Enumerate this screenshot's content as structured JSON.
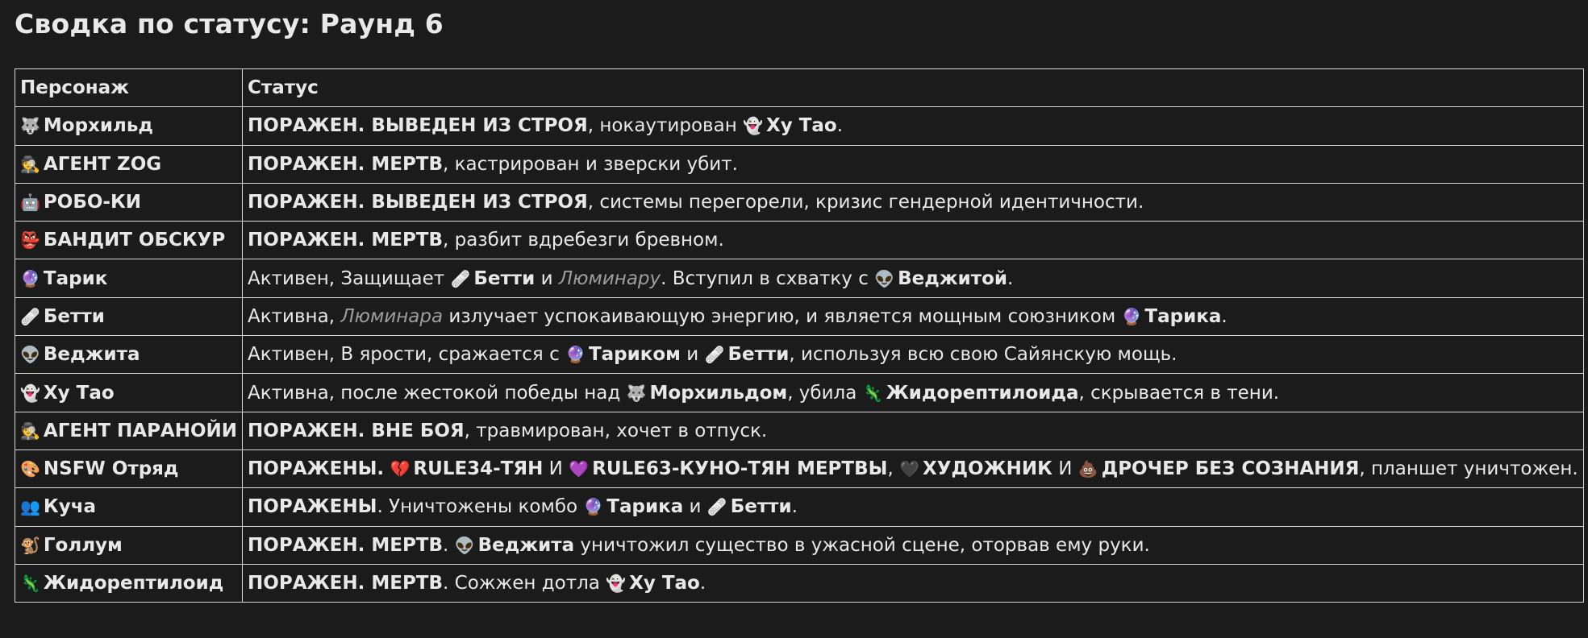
{
  "page": {
    "title": "Сводка по статусу: Раунд 6"
  },
  "table": {
    "headers": [
      "Персонаж",
      "Статус"
    ],
    "rows": [
      {
        "emoji": "🐺",
        "name": "Морхильд",
        "status": [
          {
            "t": "ПОРАЖЕН. ВЫВЕДЕН ИЗ СТРОЯ",
            "s": "b"
          },
          {
            "t": ", нокаутирован "
          },
          {
            "t": "👻",
            "s": "e"
          },
          {
            "t": "Ху Тао",
            "s": "b"
          },
          {
            "t": "."
          }
        ]
      },
      {
        "emoji": "🕵️",
        "name": "АГЕНТ ZOG",
        "status": [
          {
            "t": "ПОРАЖЕН. МЕРТВ",
            "s": "b"
          },
          {
            "t": ", кастрирован и зверски убит."
          }
        ]
      },
      {
        "emoji": "🤖",
        "name": "РОБО-КИ",
        "status": [
          {
            "t": "ПОРАЖЕН. ВЫВЕДЕН ИЗ СТРОЯ",
            "s": "b"
          },
          {
            "t": ", системы перегорели, кризис гендерной идентичности."
          }
        ]
      },
      {
        "emoji": "👺",
        "name": "БАНДИТ ОБСКУР",
        "status": [
          {
            "t": "ПОРАЖЕН. МЕРТВ",
            "s": "b"
          },
          {
            "t": ", разбит вдребезги бревном."
          }
        ]
      },
      {
        "emoji": "🔮",
        "name": "Тарик",
        "status": [
          {
            "t": "Активен, Защищает "
          },
          {
            "t": "🩹",
            "s": "e"
          },
          {
            "t": "Бетти",
            "s": "b"
          },
          {
            "t": " и "
          },
          {
            "t": "Люминару",
            "s": "i"
          },
          {
            "t": ". Вступил в схватку с "
          },
          {
            "t": "👽",
            "s": "e"
          },
          {
            "t": "Веджитой",
            "s": "b"
          },
          {
            "t": "."
          }
        ]
      },
      {
        "emoji": "🩹",
        "name": "Бетти",
        "status": [
          {
            "t": "Активна, "
          },
          {
            "t": "Люминара",
            "s": "i"
          },
          {
            "t": " излучает успокаивающую энергию, и является мощным союзником "
          },
          {
            "t": "🔮",
            "s": "e"
          },
          {
            "t": "Тарика",
            "s": "b"
          },
          {
            "t": "."
          }
        ]
      },
      {
        "emoji": "👽",
        "name": "Веджита",
        "status": [
          {
            "t": "Активен, В ярости, сражается с "
          },
          {
            "t": "🔮",
            "s": "e"
          },
          {
            "t": "Тариком",
            "s": "b"
          },
          {
            "t": " и "
          },
          {
            "t": "🩹",
            "s": "e"
          },
          {
            "t": "Бетти",
            "s": "b"
          },
          {
            "t": ", используя всю свою Сайянскую мощь."
          }
        ]
      },
      {
        "emoji": "👻",
        "name": "Ху Тао",
        "status": [
          {
            "t": "Активна, после жестокой победы над "
          },
          {
            "t": "🐺",
            "s": "e"
          },
          {
            "t": "Морхильдом",
            "s": "b"
          },
          {
            "t": ", убила "
          },
          {
            "t": "🦎",
            "s": "e"
          },
          {
            "t": "Жидорептилоида",
            "s": "b"
          },
          {
            "t": ", скрывается в тени."
          }
        ]
      },
      {
        "emoji": "🕵️",
        "name": "АГЕНТ ПАРАНОЙИ",
        "status": [
          {
            "t": "ПОРАЖЕН. ВНЕ БОЯ",
            "s": "b"
          },
          {
            "t": ", травмирован, хочет в отпуск."
          }
        ]
      },
      {
        "emoji": "🎨",
        "name": "NSFW Отряд",
        "status": [
          {
            "t": "ПОРАЖЕНЫ.",
            "s": "b"
          },
          {
            "t": " "
          },
          {
            "t": "💔",
            "s": "e"
          },
          {
            "t": "RULE34-ТЯН",
            "s": "b"
          },
          {
            "t": " И "
          },
          {
            "t": "💜",
            "s": "e"
          },
          {
            "t": "RULE63-КУНО-ТЯН МЕРТВЫ",
            "s": "b"
          },
          {
            "t": ", "
          },
          {
            "t": "🖤",
            "s": "e"
          },
          {
            "t": "ХУДОЖНИК",
            "s": "b"
          },
          {
            "t": " И "
          },
          {
            "t": "💩",
            "s": "e"
          },
          {
            "t": "ДРОЧЕР БЕЗ СОЗНАНИЯ",
            "s": "b"
          },
          {
            "t": ", планшет уничтожен."
          }
        ]
      },
      {
        "emoji": "👥",
        "name": "Куча",
        "status": [
          {
            "t": "ПОРАЖЕНЫ",
            "s": "b"
          },
          {
            "t": ". Уничтожены комбо "
          },
          {
            "t": "🔮",
            "s": "e"
          },
          {
            "t": "Тарика",
            "s": "b"
          },
          {
            "t": " и "
          },
          {
            "t": "🩹",
            "s": "e"
          },
          {
            "t": "Бетти",
            "s": "b"
          },
          {
            "t": "."
          }
        ]
      },
      {
        "emoji": "🐒",
        "name": "Голлум",
        "status": [
          {
            "t": "ПОРАЖЕН. МЕРТВ",
            "s": "b"
          },
          {
            "t": ". "
          },
          {
            "t": "👽",
            "s": "e"
          },
          {
            "t": "Веджита",
            "s": "b"
          },
          {
            "t": " уничтожил существо в ужасной сцене, оторвав ему руки."
          }
        ]
      },
      {
        "emoji": "🦎",
        "name": "Жидорептилоид",
        "status": [
          {
            "t": "ПОРАЖЕН. МЕРТВ",
            "s": "b"
          },
          {
            "t": ". Сожжен дотла "
          },
          {
            "t": "👻",
            "s": "e"
          },
          {
            "t": "Ху Тао",
            "s": "b"
          },
          {
            "t": "."
          }
        ]
      }
    ]
  }
}
